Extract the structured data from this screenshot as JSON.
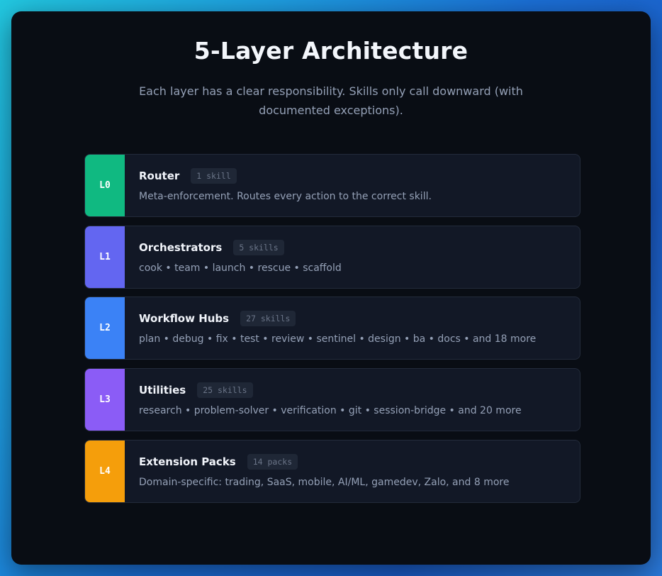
{
  "title": "5-Layer Architecture",
  "subtitle": "Each layer has a clear responsibility. Skills only call downward (with documented exceptions).",
  "layers": [
    {
      "id": "L0",
      "name": "Router",
      "count": "1 skill",
      "description": "Meta-enforcement. Routes every action to the correct skill.",
      "color": "#10b981"
    },
    {
      "id": "L1",
      "name": "Orchestrators",
      "count": "5 skills",
      "description": "cook • team • launch • rescue • scaffold",
      "color": "#6366f1"
    },
    {
      "id": "L2",
      "name": "Workflow Hubs",
      "count": "27 skills",
      "description": "plan • debug • fix • test • review • sentinel • design • ba • docs • and 18 more",
      "color": "#3b82f6"
    },
    {
      "id": "L3",
      "name": "Utilities",
      "count": "25 skills",
      "description": "research • problem-solver • verification • git • session-bridge • and 20 more",
      "color": "#8b5cf6"
    },
    {
      "id": "L4",
      "name": "Extension Packs",
      "count": "14 packs",
      "description": "Domain-specific: trading, SaaS, mobile, AI/ML, gamedev, Zalo, and 8 more",
      "color": "#f59e0b"
    }
  ]
}
